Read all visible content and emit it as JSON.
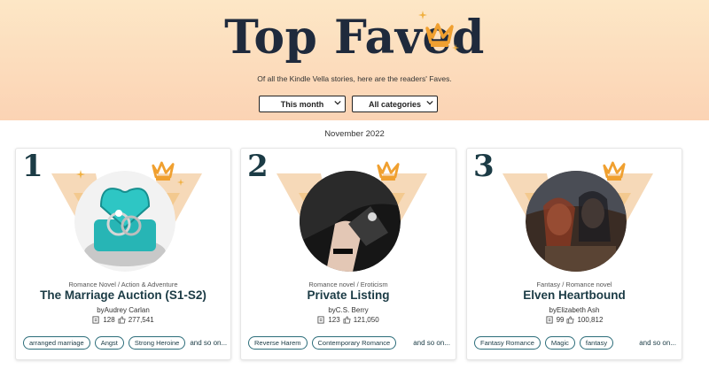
{
  "header": {
    "title": "Top Faved",
    "subtitle": "Of all the Kindle Vella stories, here are the readers' Faves.",
    "filters": {
      "period": "This month",
      "category": "All categories"
    },
    "accent": "#f0a030"
  },
  "month": "November 2022",
  "cards": [
    {
      "rank": "1",
      "genre": "Romance Novel / Action & Adventure",
      "title": "The Marriage Auction (S1-S2)",
      "author": "byAudrey Carlan",
      "episodes": "128",
      "faves": "277,541",
      "tags": [
        "arranged marriage",
        "Angst",
        "Strong Heroine"
      ],
      "more": "and so on..."
    },
    {
      "rank": "2",
      "genre": "Romance novel / Eroticism",
      "title": "Private Listing",
      "author": "byC.S. Berry",
      "episodes": "123",
      "faves": "121,050",
      "tags": [
        "Reverse Harem",
        "Contemporary Romance"
      ],
      "more": "and so on..."
    },
    {
      "rank": "3",
      "genre": "Fantasy / Romance novel",
      "title": "Elven Heartbound",
      "author": "byElizabeth Ash",
      "episodes": "99",
      "faves": "100,812",
      "tags": [
        "Fantasy Romance",
        "Magic",
        "fantasy"
      ],
      "more": "and so on..."
    }
  ],
  "icons": [
    "crown-icon",
    "sparkle-icon",
    "episodes-icon",
    "thumbs-up-icon",
    "chevron-down-icon"
  ]
}
